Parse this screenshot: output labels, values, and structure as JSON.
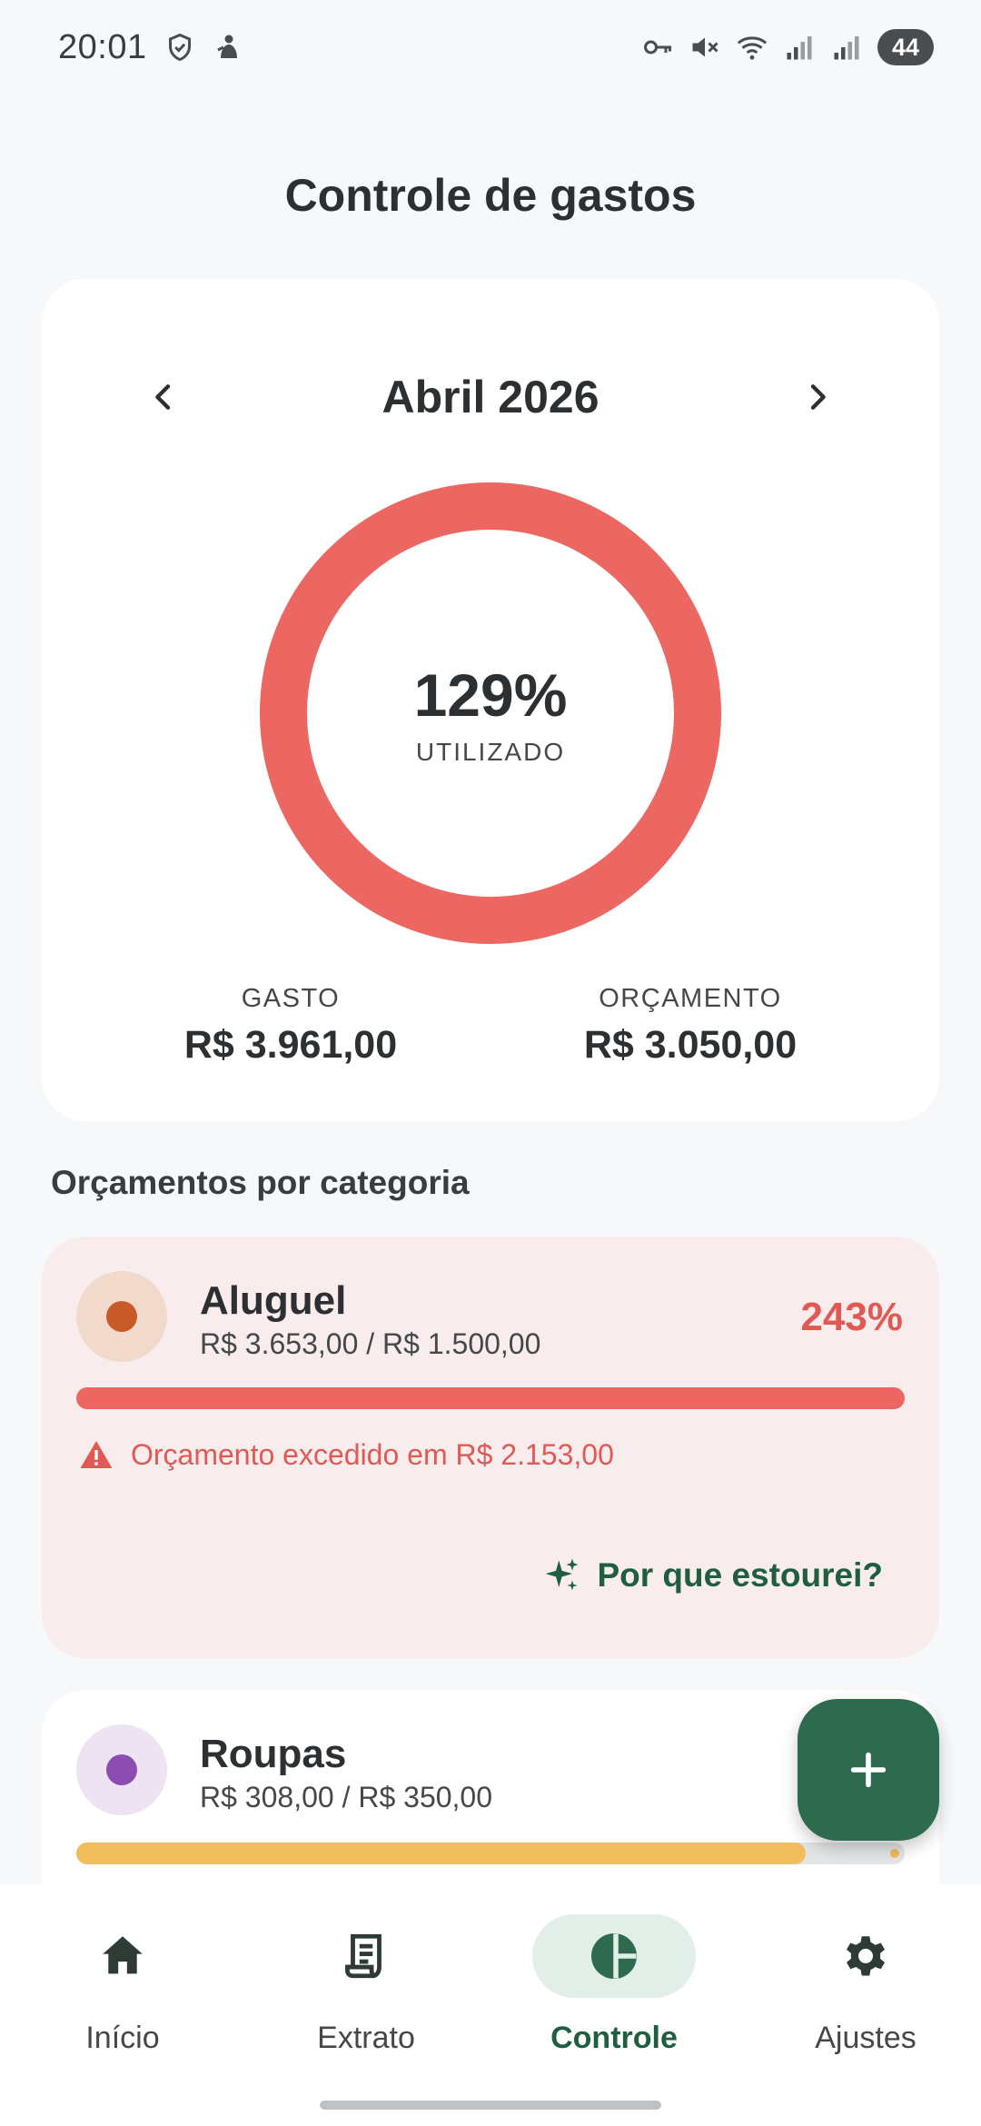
{
  "status_bar": {
    "time": "20:01",
    "left_icons": [
      "shield-check-icon",
      "notification-icon"
    ],
    "right_icons": [
      "vpn-key-icon",
      "mute-icon",
      "wifi-icon",
      "signal-icon",
      "signal-icon"
    ],
    "battery": "44"
  },
  "header": {
    "title": "Controle de gastos"
  },
  "summary": {
    "month": "Abril 2026",
    "prev_icon": "chevron-left-icon",
    "next_icon": "chevron-right-icon",
    "percent_used": "129%",
    "percent_caption": "UTILIZADO",
    "ring_fill_fraction": 1.0,
    "spent_label": "GASTO",
    "spent_value": "R$ 3.961,00",
    "budget_label": "ORÇAMENTO",
    "budget_value": "R$ 3.050,00"
  },
  "section": {
    "title": "Orçamentos por categoria"
  },
  "categories": [
    {
      "name": "Aluguel",
      "amount": "R$ 3.653,00 / R$ 1.500,00",
      "percent": "243%",
      "progress": 1.0,
      "status": "exceeded",
      "warning": "Orçamento excedido em R$ 2.153,00",
      "action_label": "Por que estourei?",
      "dot_color": "#C85A28",
      "avatar_bg": "#F1DACB",
      "bar_color": "#EC6762",
      "accent_color": "#E05A55"
    },
    {
      "name": "Roupas",
      "amount": "R$ 308,00 / R$ 350,00",
      "progress": 0.88,
      "status": "warning",
      "dot_color": "#8C4CB0",
      "avatar_bg": "#EDE3F2",
      "bar_color": "#F2BD5B"
    }
  ],
  "fab": {
    "icon": "plus-icon"
  },
  "bottom_nav": {
    "items": [
      {
        "label": "Início",
        "icon": "home-icon",
        "active": false
      },
      {
        "label": "Extrato",
        "icon": "receipt-icon",
        "active": false
      },
      {
        "label": "Controle",
        "icon": "pie-chart-icon",
        "active": true
      },
      {
        "label": "Ajustes",
        "icon": "gear-icon",
        "active": false
      }
    ]
  },
  "colors": {
    "accent_green": "#2E6B4E",
    "alert_red": "#EC6762",
    "alert_card_bg": "#F8ECEC",
    "page_bg": "#F6F8FA"
  }
}
